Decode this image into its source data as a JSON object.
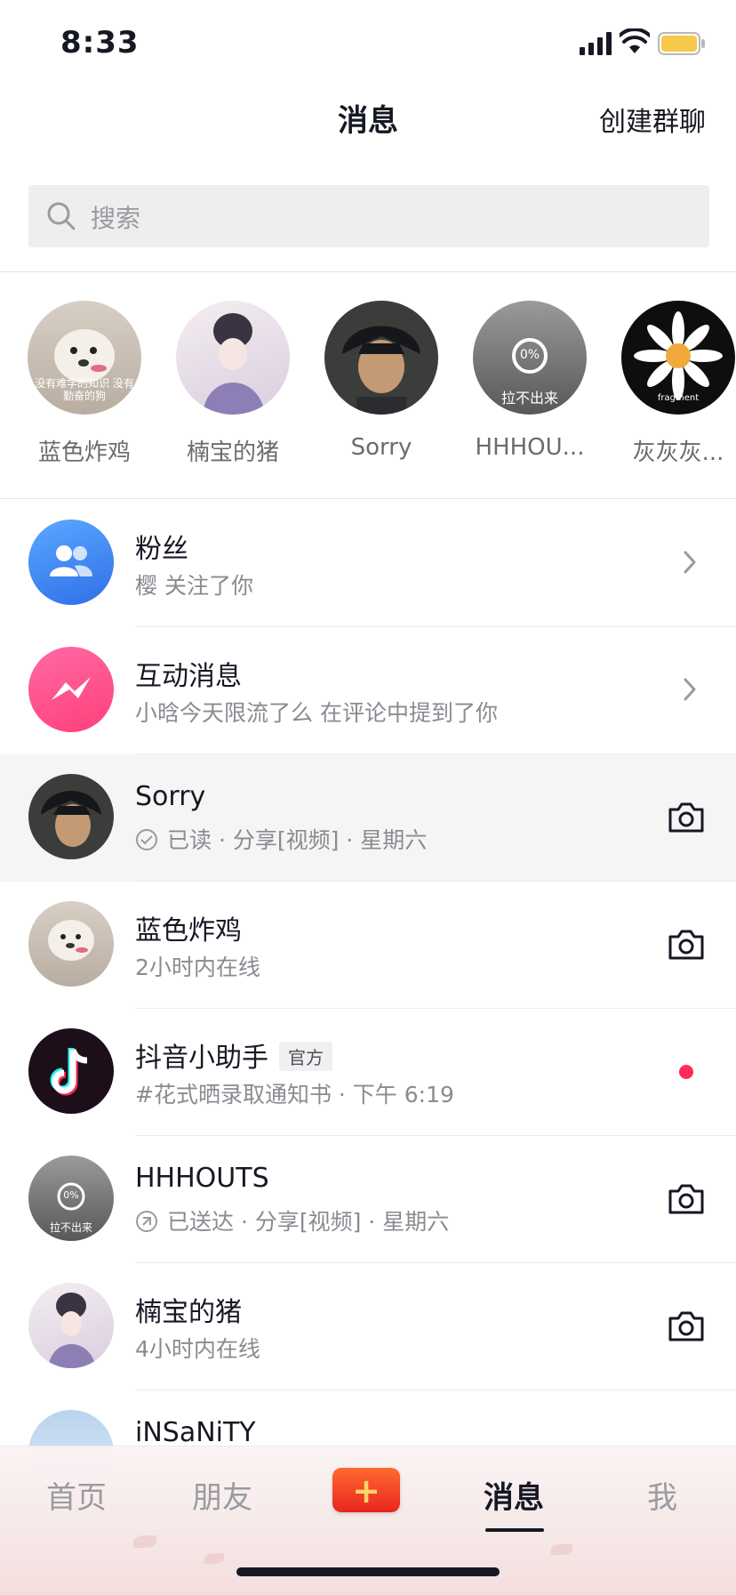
{
  "status_bar": {
    "time": "8:33"
  },
  "header": {
    "title": "消息",
    "create_group": "创建群聊"
  },
  "search": {
    "placeholder": "搜索"
  },
  "stories": [
    {
      "name": "蓝色炸鸡",
      "caption": "没有难学的知识 没有勤奋的狗"
    },
    {
      "name": "楠宝的猪"
    },
    {
      "name": "Sorry"
    },
    {
      "name": "HHHOU...",
      "progress": "0%",
      "caption": "拉不出来"
    },
    {
      "name": "灰灰灰...",
      "caption": "fragment"
    }
  ],
  "messages": [
    {
      "title": "粉丝",
      "subtitle": "樱 关注了你",
      "icon": "fans-icon",
      "action": "chevron"
    },
    {
      "title": "互动消息",
      "subtitle": "小晗今天限流了么 在评论中提到了你",
      "icon": "interaction-icon",
      "action": "chevron"
    },
    {
      "title": "Sorry",
      "subtitle": "已读 · 分享[视频] · 星期六",
      "status_icon": "read-check-icon",
      "action": "camera"
    },
    {
      "title": "蓝色炸鸡",
      "subtitle": "2小时内在线",
      "action": "camera"
    },
    {
      "title": "抖音小助手",
      "badge": "官方",
      "subtitle": "#花式晒录取通知书 · 下午 6:19",
      "icon": "tiktok-icon",
      "action": "unread-dot"
    },
    {
      "title": "HHHOUTS",
      "subtitle": "已送达 · 分享[视频] · 星期六",
      "status_icon": "sent-icon",
      "action": "camera"
    },
    {
      "title": "楠宝的猪",
      "subtitle": "4小时内在线",
      "action": "camera"
    },
    {
      "title": "iNSaNiTY"
    }
  ],
  "tabbar": {
    "home": "首页",
    "friends": "朋友",
    "create": "+",
    "messages": "消息",
    "me": "我"
  },
  "colors": {
    "accent_red": "#fe2c55",
    "fans_blue": "#3d8bf7",
    "interaction_pink": "#ff4f8b",
    "battery_yellow": "#f7c948"
  }
}
